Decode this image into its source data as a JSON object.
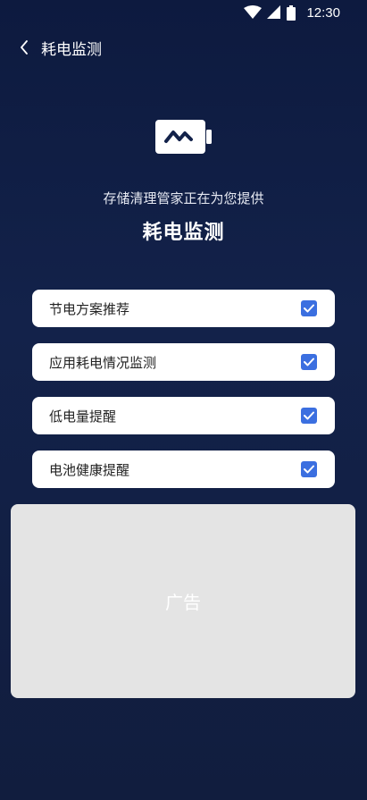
{
  "status_bar": {
    "time": "12:30"
  },
  "header": {
    "title": "耗电监测"
  },
  "hero": {
    "subtitle": "存储清理管家正在为您提供",
    "title": "耗电监测",
    "icon": "battery-pulse-icon"
  },
  "options": [
    {
      "label": "节电方案推荐",
      "checked": true
    },
    {
      "label": "应用耗电情况监测",
      "checked": true
    },
    {
      "label": "低电量提醒",
      "checked": true
    },
    {
      "label": "电池健康提醒",
      "checked": true
    }
  ],
  "ad": {
    "label": "广告"
  },
  "colors": {
    "background": "#13224a",
    "checkbox": "#3b6fe0",
    "ad_background": "#e4e4e4"
  }
}
